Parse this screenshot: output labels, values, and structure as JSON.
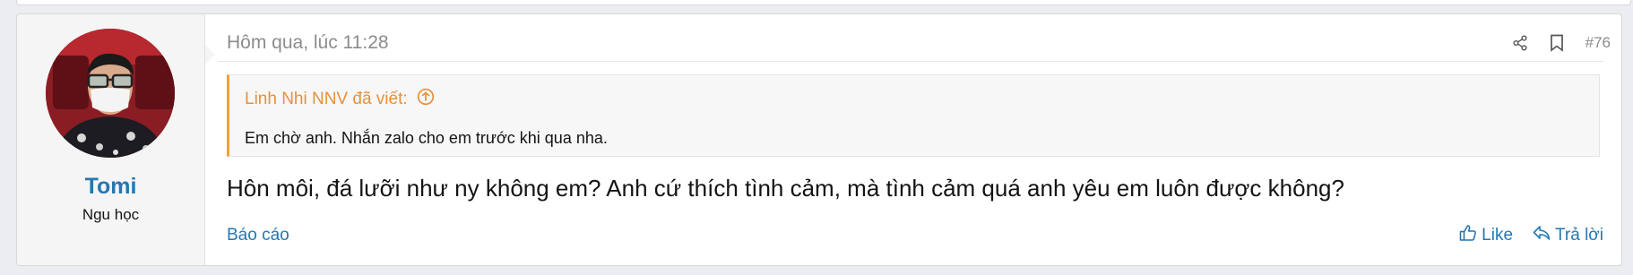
{
  "post": {
    "date": "Hôm qua, lúc 11:28",
    "number": "#76",
    "user": {
      "name": "Tomi",
      "title": "Ngu học"
    },
    "quote": {
      "header": "Linh Nhi NNV đã viết:",
      "body": "Em chờ anh. Nhắn zalo cho em trước khi qua nha."
    },
    "message": "Hôn môi, đá lưỡi như ny không em? Anh cứ thích tình cảm, mà tình cảm quá anh yêu em luôn được không?",
    "report_label": "Báo cáo",
    "like_label": "Like",
    "reply_label": "Trả lời"
  },
  "icons": {
    "share": "share-icon",
    "bookmark": "bookmark-icon",
    "quote_jump": "arrow-up-circle-icon",
    "like": "thumbs-up-icon",
    "reply": "reply-icon"
  },
  "colors": {
    "link": "#2577b1",
    "quote_accent": "#f0a23b",
    "quote_text": "#e8903b",
    "muted": "#8c8c8c"
  }
}
